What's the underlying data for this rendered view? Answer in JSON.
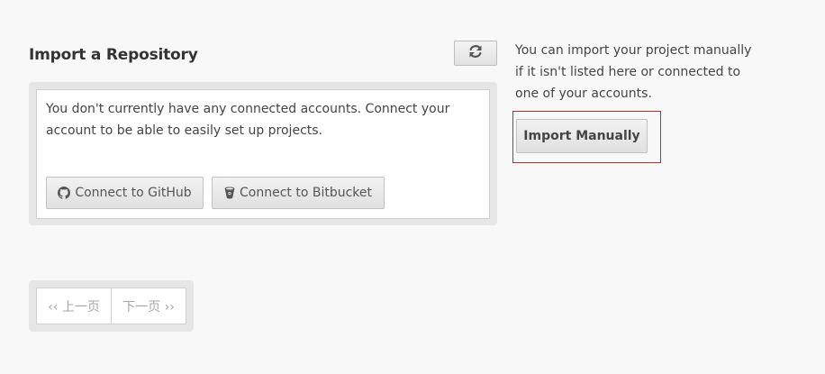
{
  "page": {
    "title": "Import a Repository",
    "refresh_icon": "refresh-icon"
  },
  "panel": {
    "message": "You don't currently have any connected accounts. Connect your account to be able to easily set up projects.",
    "github_button": {
      "label": "Connect to GitHub",
      "icon": "github-icon"
    },
    "bitbucket_button": {
      "label": "Connect to Bitbucket",
      "icon": "bitbucket-icon"
    }
  },
  "sidebar": {
    "text": "You can import your project manually if it isn't listed here or connected to one of your accounts.",
    "import_button": {
      "label": "Import Manually"
    },
    "highlight_color": "#c62828"
  },
  "pagination": {
    "prev_label": "‹‹ 上一页",
    "next_label": "下一页 ››"
  },
  "colors": {
    "background": "#f8f8f8",
    "panel_border": "#e6e6e6",
    "text": "#444444",
    "disabled_text": "#a6a6a6"
  }
}
